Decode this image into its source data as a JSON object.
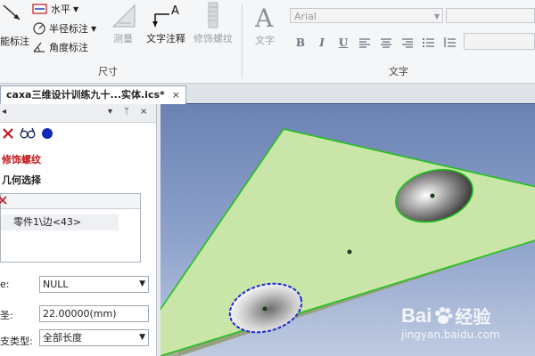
{
  "ribbon": {
    "dimension_group": {
      "label": "尺寸",
      "left_cut_label": "能标注",
      "horizontal_label": "水平",
      "radius_label": "半径标注",
      "angle_label": "角度标注",
      "measure_label": "测量",
      "text_annotation_label": "文字注释",
      "decor_thread_label": "修饰螺纹"
    },
    "text_group": {
      "label": "文字",
      "text_button_label": "文字",
      "font_name": "Arial",
      "format_buttons": [
        "B",
        "I",
        "U"
      ]
    }
  },
  "tabs": [
    {
      "label": "caxa三维设计训练九十...实体.ics*",
      "close": "×"
    }
  ],
  "panel": {
    "controls": [
      "▾",
      "ᛘ",
      "×"
    ],
    "title": "修饰螺纹",
    "geometry_section": "几何选择",
    "selected_item": "零件1\\边<43>",
    "fields": [
      {
        "label": "e:",
        "value": "NULL",
        "type": "select"
      },
      {
        "label": "圣:",
        "value": "22.00000(mm)",
        "type": "input"
      },
      {
        "label": "支类型:",
        "value": "全部长度",
        "type": "select"
      }
    ]
  },
  "watermark": {
    "brand": "Bai",
    "brand2": "经验",
    "url": "jingyan.baidu.com"
  },
  "colors": {
    "accent_red": "#c0161b",
    "part_face": "#c9e6a8",
    "edge_highlight": "#22c01e",
    "selected_edge": "#1f2ad0"
  }
}
